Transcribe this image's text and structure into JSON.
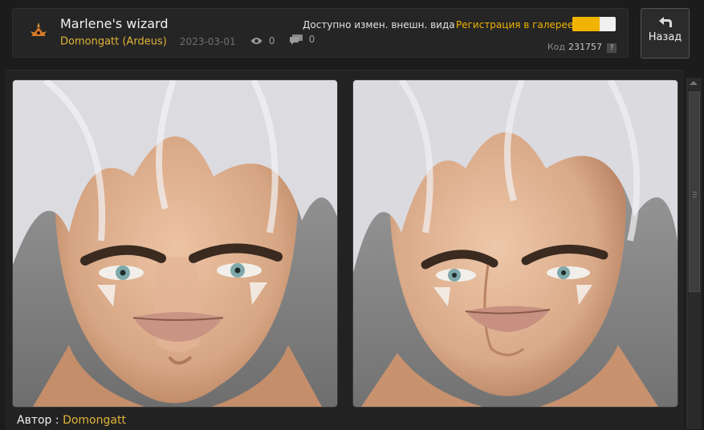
{
  "header": {
    "title": "Marlene's wizard",
    "author": "Domongatt (Ardeus)",
    "date": "2023-03-01",
    "views": "0",
    "comments": "0",
    "status_text": "Доступно измен. внешн. вида",
    "gallery_label": "Регистрация в галерее",
    "gallery_toggle_fill": 0.63,
    "code_label": "Код",
    "code_value": "231757",
    "help_label": "?",
    "icons": {
      "class": "class-emblem-icon",
      "views": "eye-icon",
      "comments": "speech-bubble-icon"
    }
  },
  "back_button": {
    "label": "Назад",
    "icon": "back-arrow-icon"
  },
  "preview": {
    "images": [
      {
        "name": "face-preview-front"
      },
      {
        "name": "face-preview-angled"
      }
    ]
  },
  "footer": {
    "author_label": "Автор :",
    "author_name": "Domongatt"
  },
  "colors": {
    "accent": "#f0b400",
    "author": "#e0b43a",
    "background": "#1c1c1c",
    "panel": "#252525"
  }
}
